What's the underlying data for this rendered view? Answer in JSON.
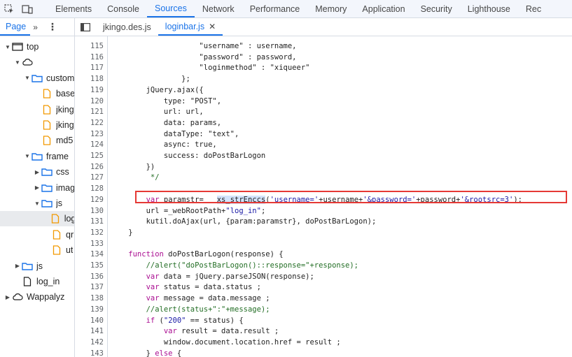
{
  "toolbar": {
    "tabs": [
      "Elements",
      "Console",
      "Sources",
      "Network",
      "Performance",
      "Memory",
      "Application",
      "Security",
      "Lighthouse",
      "Rec"
    ],
    "active_tab": "Sources"
  },
  "subbar": {
    "page_label": "Page",
    "chevron": "»",
    "kebab": "⋮",
    "files": [
      "jkingo.des.js",
      "loginbar.js"
    ],
    "active_file": "loginbar.js",
    "close": "✕"
  },
  "tree": [
    {
      "label": "top",
      "indent": 0,
      "expanded": true,
      "icon": "frame-icon"
    },
    {
      "label": "",
      "indent": 1,
      "expanded": true,
      "icon": "cloud-icon"
    },
    {
      "label": "custom",
      "indent": 2,
      "expanded": true,
      "icon": "folder-icon"
    },
    {
      "label": "base",
      "indent": 3,
      "icon": "file-icon"
    },
    {
      "label": "jking",
      "indent": 3,
      "icon": "file-icon"
    },
    {
      "label": "jking",
      "indent": 3,
      "icon": "file-icon"
    },
    {
      "label": "md5",
      "indent": 3,
      "icon": "file-icon"
    },
    {
      "label": "frame",
      "indent": 2,
      "expanded": true,
      "icon": "folder-icon"
    },
    {
      "label": "css",
      "indent": 3,
      "expanded": false,
      "icon": "folder-icon"
    },
    {
      "label": "imag",
      "indent": 3,
      "expanded": false,
      "icon": "folder-icon"
    },
    {
      "label": "js",
      "indent": 3,
      "expanded": true,
      "icon": "folder-icon"
    },
    {
      "label": "log",
      "indent": 4,
      "icon": "file-icon",
      "selected": true
    },
    {
      "label": "qr",
      "indent": 4,
      "icon": "file-icon"
    },
    {
      "label": "ut",
      "indent": 4,
      "icon": "file-icon"
    },
    {
      "label": "js",
      "indent": 1,
      "expanded": false,
      "icon": "folder-icon"
    },
    {
      "label": "log_in",
      "indent": 1,
      "icon": "file-gray-icon"
    },
    {
      "label": "Wappalyz",
      "indent": 0,
      "expanded": false,
      "icon": "cloud-icon"
    }
  ],
  "code": {
    "line_numbers": [
      115,
      116,
      117,
      118,
      119,
      120,
      121,
      122,
      123,
      124,
      125,
      126,
      127,
      128,
      129,
      130,
      131,
      132,
      133,
      134,
      135,
      136,
      137,
      138,
      139,
      140,
      141,
      142,
      143
    ],
    "lines": [
      [
        [
          "t",
          "                    \"username\" : username,"
        ]
      ],
      [
        [
          "t",
          "                    \"password\" : password,"
        ]
      ],
      [
        [
          "t",
          "                    \"loginmethod\" : \"xiqueer\""
        ]
      ],
      [
        [
          "t",
          "                };"
        ]
      ],
      [
        [
          "t",
          "        jQuery.ajax({"
        ]
      ],
      [
        [
          "t",
          "            type: \"POST\","
        ]
      ],
      [
        [
          "t",
          "            url: url,"
        ]
      ],
      [
        [
          "t",
          "            data: params,"
        ]
      ],
      [
        [
          "t",
          "            dataType: \"text\","
        ]
      ],
      [
        [
          "t",
          "            async: true,"
        ]
      ],
      [
        [
          "t",
          "            success: doPostBarLogon"
        ]
      ],
      [
        [
          "t",
          "        })"
        ]
      ],
      [
        [
          "c",
          "         */"
        ]
      ],
      [
        [
          "t",
          ""
        ]
      ],
      [
        [
          "k",
          "        var"
        ],
        [
          "t",
          " paramstr=   "
        ],
        [
          "h",
          "xs_strEnccs"
        ],
        [
          "t",
          "("
        ],
        [
          "s",
          "'username='"
        ],
        [
          "t",
          "+username+"
        ],
        [
          "s",
          "'&password='"
        ],
        [
          "t",
          "+password+"
        ],
        [
          "s",
          "'&rootsrc=3'"
        ],
        [
          "t",
          ");"
        ]
      ],
      [
        [
          "t",
          "        url ="
        ],
        [
          "t",
          "_webRootPath+"
        ],
        [
          "s",
          "\"log_in\""
        ],
        [
          "t",
          ";"
        ]
      ],
      [
        [
          "t",
          "        kutil.doAjax(url, {param:paramstr}, doPostBarLogon);"
        ]
      ],
      [
        [
          "t",
          "    }"
        ]
      ],
      [
        [
          "t",
          ""
        ]
      ],
      [
        [
          "k",
          "    function"
        ],
        [
          "t",
          " doPostBarLogon(response) {"
        ]
      ],
      [
        [
          "c",
          "        //alert(\"doPostBarLogon()::response=\"+response);"
        ]
      ],
      [
        [
          "k",
          "        var"
        ],
        [
          "t",
          " data = jQuery.parseJSON(response);"
        ]
      ],
      [
        [
          "k",
          "        var"
        ],
        [
          "t",
          " status = data.status ;"
        ]
      ],
      [
        [
          "k",
          "        var"
        ],
        [
          "t",
          " message = data.message ;"
        ]
      ],
      [
        [
          "c",
          "        //alert(status+\":\"+message);"
        ]
      ],
      [
        [
          "k",
          "        if"
        ],
        [
          "t",
          " ("
        ],
        [
          "s",
          "\"200\""
        ],
        [
          "t",
          " == status) {"
        ]
      ],
      [
        [
          "k",
          "            var"
        ],
        [
          "t",
          " result = data.result ;"
        ]
      ],
      [
        [
          "t",
          "            window.document.location.href = result ;"
        ]
      ],
      [
        [
          "t",
          "        } "
        ],
        [
          "k",
          "else"
        ],
        [
          "t",
          " {"
        ]
      ]
    ]
  }
}
